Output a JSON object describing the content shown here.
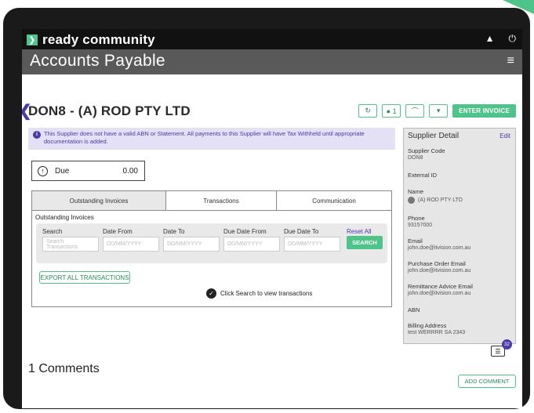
{
  "brand": {
    "name": "ready community",
    "accent": "#4fc48a"
  },
  "header": {
    "title": "Accounts Payable"
  },
  "supplier": {
    "title": "DON8 - (A) ROD PTY LTD",
    "actions": {
      "notes_count": "1",
      "enter_invoice_label": "ENTER INVOICE"
    }
  },
  "warning": {
    "text": "This Supplier does not have a valid ABN or Statement. All payments to this Supplier will have Tax Withheld until appropriate documentation is added."
  },
  "due": {
    "label": "Due",
    "amount": "0.00"
  },
  "tabs": [
    {
      "label": "Outstanding Invoices"
    },
    {
      "label": "Transactions"
    },
    {
      "label": "Communication"
    }
  ],
  "panel": {
    "title": "Outstanding Invoices",
    "filters": {
      "search_label": "Search",
      "search_placeholder": "Search Transactions",
      "date_from_label": "Date From",
      "date_to_label": "Date To",
      "due_from_label": "Due Date From",
      "due_to_label": "Due Date To",
      "date_placeholder": "DD/MM/YYYY",
      "reset_label": "Reset All",
      "search_button": "SEARCH"
    },
    "export_label": "EXPORT ALL TRANSACTIONS",
    "hint": "Click Search to view transactions"
  },
  "detail": {
    "heading": "Supplier Detail",
    "edit": "Edit",
    "code_label": "Supplier Code",
    "code": "DON8",
    "external_label": "External ID",
    "name_label": "Name",
    "name": "(A) ROD PTY LTD",
    "phone_label": "Phone",
    "phone": "93157000",
    "email_label": "Email",
    "email": "john.doe@itvision.com.au",
    "po_email_label": "Purchase Order Email",
    "po_email": "john.doe@itvision.com.au",
    "remit_email_label": "Remittance Advice Email",
    "remit_email": "john.doe@itvision.com.au",
    "abn_label": "ABN",
    "billing_label": "Billing Address",
    "billing": "test WERRRR SA 2343"
  },
  "notes_badge": "32",
  "comments": {
    "title": "1 Comments",
    "add_label": "ADD COMMENT"
  }
}
